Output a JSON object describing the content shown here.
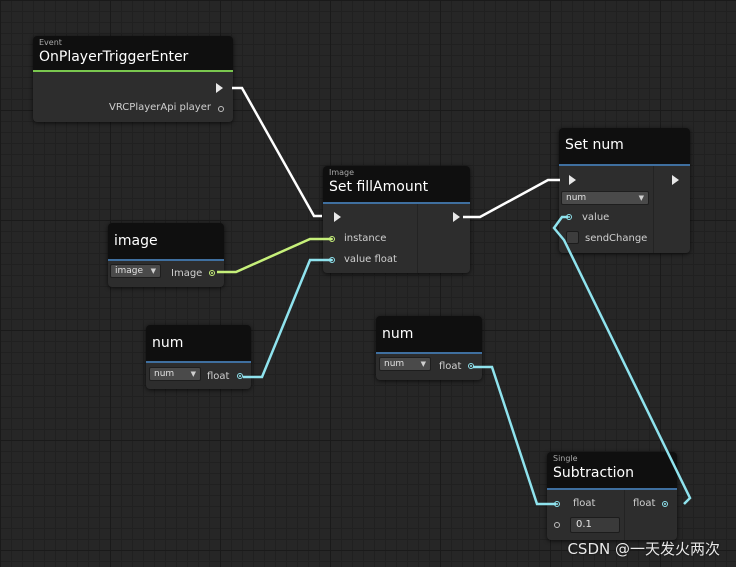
{
  "colors": {
    "flow_wire": "#ffffff",
    "float_wire": "#8fe3ee",
    "image_wire": "#c6f07a",
    "event_accent": "#7ac74f",
    "header_accent": "#3f6f9f"
  },
  "nodes": {
    "event": {
      "subtitle": "Event",
      "title": "OnPlayerTriggerEnter",
      "out_port": "VRCPlayerApi player"
    },
    "image_var": {
      "title": "image",
      "dropdown": "image",
      "out_port": "Image"
    },
    "num_var_left": {
      "title": "num",
      "dropdown": "num",
      "out_port": "float"
    },
    "set_fill": {
      "subtitle": "Image",
      "title": "Set fillAmount",
      "in_instance": "instance",
      "in_value": "value float"
    },
    "num_var_mid": {
      "title": "num",
      "dropdown": "num",
      "out_port": "float"
    },
    "set_num": {
      "title": "Set num",
      "dropdown": "num",
      "in_value": "value",
      "in_send": "sendChange"
    },
    "subtraction": {
      "subtitle": "Single",
      "title": "Subtraction",
      "in_a": "float",
      "in_b_value": "0.1",
      "out_port": "float"
    }
  },
  "watermark": "CSDN @一天发火两次"
}
